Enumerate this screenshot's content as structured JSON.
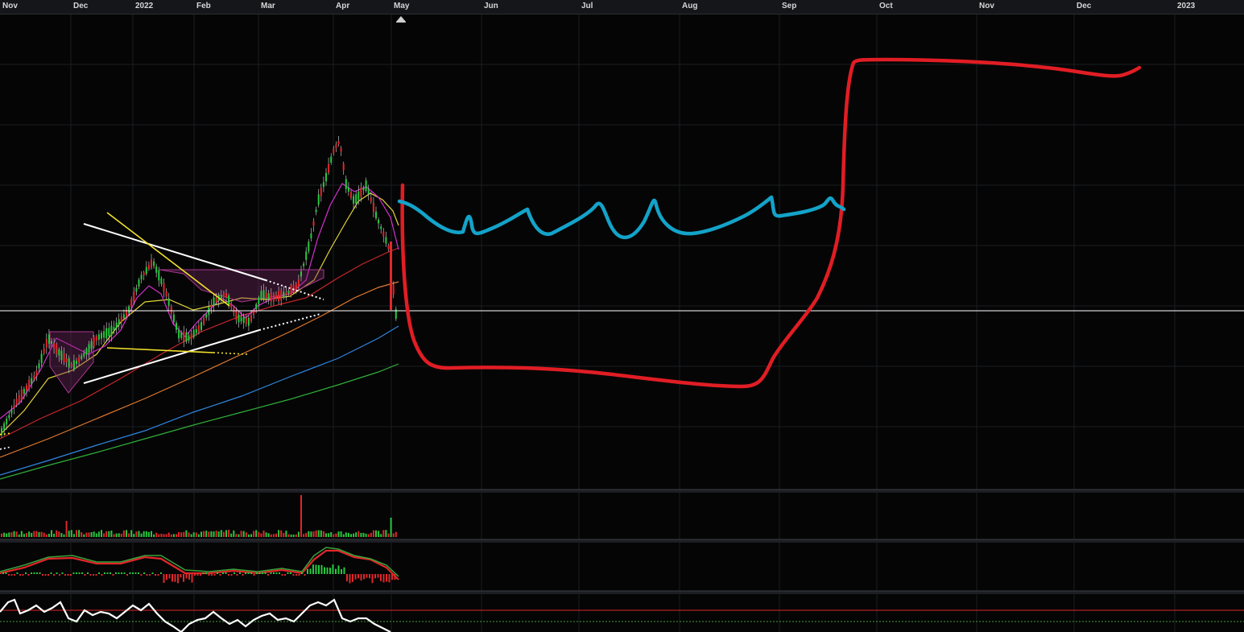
{
  "x_axis": {
    "months": [
      "Nov",
      "Dec",
      "2022",
      "Feb",
      "Mar",
      "Apr",
      "May",
      "Jun",
      "Jul",
      "Aug",
      "Sep",
      "Oct",
      "Nov",
      "Dec",
      "2023"
    ]
  },
  "colors": {
    "background": "#050505",
    "panel_divider": "#3a3d44",
    "grid": "#1b1d21",
    "candle_up": "#27c93f",
    "candle_down": "#e0272a",
    "ma_10": "#d62fd0",
    "ma_21": "#e3d33a",
    "ma_50": "#c8262a",
    "ma_100": "#e07a2e",
    "ma_150": "#2f86e0",
    "ma_200": "#2fae3a",
    "annotation_red": "#e11d24",
    "annotation_cyan": "#13a3c9",
    "trendline_white": "#ffffff",
    "trendline_yellow": "#f2e22b",
    "horizontal_line": "#ffffff",
    "base_box": "#7a2a6a"
  },
  "chart_data": [
    {
      "type": "candlestick",
      "panel": "price",
      "x": [
        "Nov",
        "Dec",
        "2022",
        "Feb",
        "Mar",
        "Apr",
        "May",
        "Jun",
        "Jul",
        "Aug",
        "Sep",
        "Oct",
        "Nov",
        "Dec",
        "2023"
      ],
      "title": "",
      "grid": true,
      "legend": "none",
      "series": [
        {
          "name": "",
          "kind": "moving-average",
          "color": "ma_10"
        },
        {
          "name": "",
          "kind": "moving-average",
          "color": "ma_21"
        },
        {
          "name": "",
          "kind": "moving-average",
          "color": "ma_50"
        },
        {
          "name": "",
          "kind": "moving-average",
          "color": "ma_100"
        },
        {
          "name": "",
          "kind": "moving-average",
          "color": "ma_150"
        },
        {
          "name": "",
          "kind": "moving-average",
          "color": "ma_200"
        }
      ],
      "annotations": [
        "hand-drawn red cup-and-handle projection",
        "hand-drawn cyan wavy consolidation",
        "white triangle trendlines",
        "yellow descending trendline",
        "horizontal white level line"
      ]
    },
    {
      "type": "bar",
      "panel": "volume",
      "title": ""
    },
    {
      "type": "line",
      "panel": "macd",
      "title": ""
    },
    {
      "type": "line",
      "panel": "oscillator",
      "title": ""
    }
  ]
}
